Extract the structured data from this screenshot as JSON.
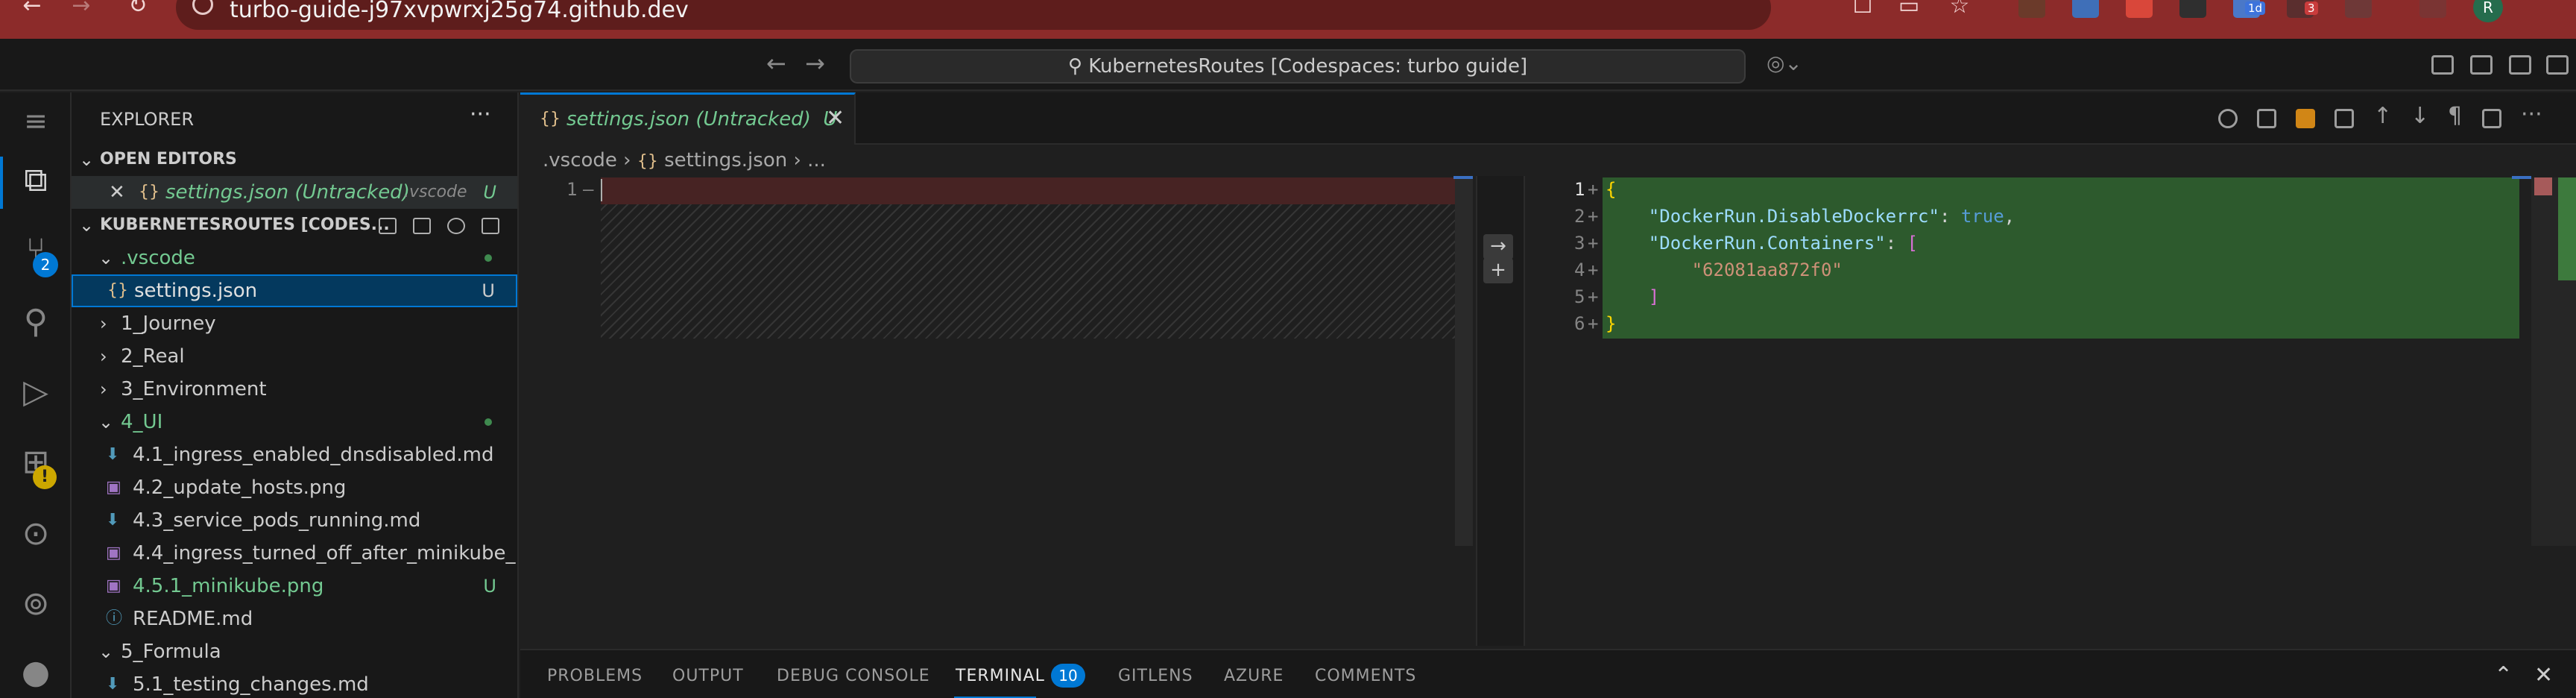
{
  "browser": {
    "url": "turbo-guide-j97xvpwrxj25g74.github.dev",
    "ext_badge_1": "1d",
    "ext_badge_2": "3",
    "profile_initial": "R"
  },
  "titlebar": {
    "command_center": "KubernetesRoutes [Codespaces: turbo guide]"
  },
  "activitybar": {
    "scm_badge": "2",
    "warning_badge": "!"
  },
  "sidebar": {
    "title": "EXPLORER",
    "open_editors_header": "OPEN EDITORS",
    "open_editor": {
      "name": "settings.json (Untracked)",
      "folder": ".vscode",
      "status": "U"
    },
    "workspace_header": "KUBERNETESROUTES [CODES...",
    "tree": [
      {
        "label": ".vscode",
        "status": ""
      },
      {
        "label": "settings.json",
        "status": "U"
      },
      {
        "label": "1_Journey",
        "status": ""
      },
      {
        "label": "2_Real",
        "status": ""
      },
      {
        "label": "3_Environment",
        "status": ""
      },
      {
        "label": "4_UI",
        "status": ""
      },
      {
        "label": "4.1_ingress_enabled_dnsdisabled.md",
        "status": ""
      },
      {
        "label": "4.2_update_hosts.png",
        "status": ""
      },
      {
        "label": "4.3_service_pods_running.md",
        "status": ""
      },
      {
        "label": "4.4_ingress_turned_off_after_minikube_...",
        "status": ""
      },
      {
        "label": "4.5.1_minikube.png",
        "status": "U"
      },
      {
        "label": "README.md",
        "status": ""
      },
      {
        "label": "5_Formula",
        "status": ""
      },
      {
        "label": "5.1_testing_changes.md",
        "status": ""
      }
    ]
  },
  "editor": {
    "tab_label": "settings.json (Untracked)",
    "tab_status": "U",
    "breadcrumb": {
      "folder": ".vscode",
      "file": "settings.json",
      "more": "..."
    },
    "left_lines": [
      "1"
    ],
    "right_lines": [
      "1",
      "2",
      "3",
      "4",
      "5",
      "6"
    ],
    "code": {
      "l1": "{",
      "l2_key": "\"DockerRun.DisableDockerrc\"",
      "l2_val": "true",
      "l3_key": "\"DockerRun.Containers\"",
      "l3_open": "[",
      "l4_val": "\"62081aa872f0\"",
      "l5": "]",
      "l6": "}"
    }
  },
  "panel": {
    "tabs": [
      "PROBLEMS",
      "OUTPUT",
      "DEBUG CONSOLE",
      "TERMINAL",
      "GITLENS",
      "AZURE",
      "COMMENTS"
    ],
    "terminal_badge": "10"
  }
}
